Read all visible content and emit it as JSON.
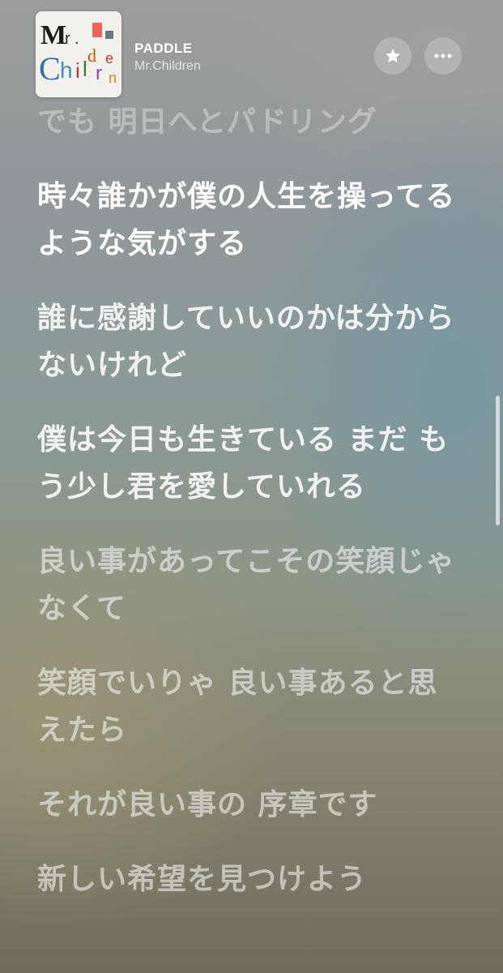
{
  "now_playing": {
    "title": "PADDLE",
    "artist": "Mr.Children",
    "album_art_text": "Mr.Children"
  },
  "controls": {
    "favorite_icon": "star-icon",
    "more_icon": "ellipsis-icon"
  },
  "lyrics": [
    {
      "text": "でも 明日へとパドリング",
      "state": "faded"
    },
    {
      "text": "時々誰かが僕の人生を操ってるような気がする",
      "state": "active"
    },
    {
      "text": "誰に感謝していいのかは分からないけれど",
      "state": "sung"
    },
    {
      "text": "僕は今日も生きている まだ もう少し君を愛していれる",
      "state": "sung"
    },
    {
      "text": "良い事があってこその笑顔じゃなくて",
      "state": "upcoming"
    },
    {
      "text": "笑顔でいりゃ 良い事あると思えたら",
      "state": "upcoming"
    },
    {
      "text": "それが良い事の 序章です",
      "state": "upcoming"
    },
    {
      "text": "新しい希望を見つけよう",
      "state": "upcoming"
    }
  ]
}
